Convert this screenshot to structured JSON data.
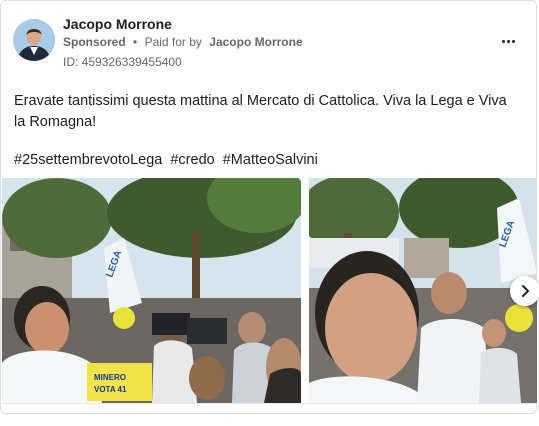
{
  "ad": {
    "page_name": "Jacopo Morrone",
    "sponsored_label": "Sponsored",
    "separator": "•",
    "paid_for_prefix": "Paid for by",
    "paid_for_name": "Jacopo Morrone",
    "id_label": "ID: 459326339455400",
    "more_icon": "more-horizontal-icon"
  },
  "post": {
    "text": "Eravate tantissimi questa mattina al Mercato di Cattolica. Viva la Lega e Viva la Romagna!",
    "hashtags": [
      "#25settembrevotoLega",
      "#credo",
      "#MatteoSalvini"
    ]
  },
  "carousel": {
    "next_icon": "chevron-right-icon",
    "photo_1": {
      "sign_text": [
        "LEGA",
        "MINERO",
        "VOTA 41"
      ]
    },
    "photo_2": {
      "sign_text": [
        "LEGA"
      ]
    }
  },
  "colors": {
    "text": "#1c1e21",
    "secondary_text": "#65676b",
    "border": "#dddfe2"
  }
}
